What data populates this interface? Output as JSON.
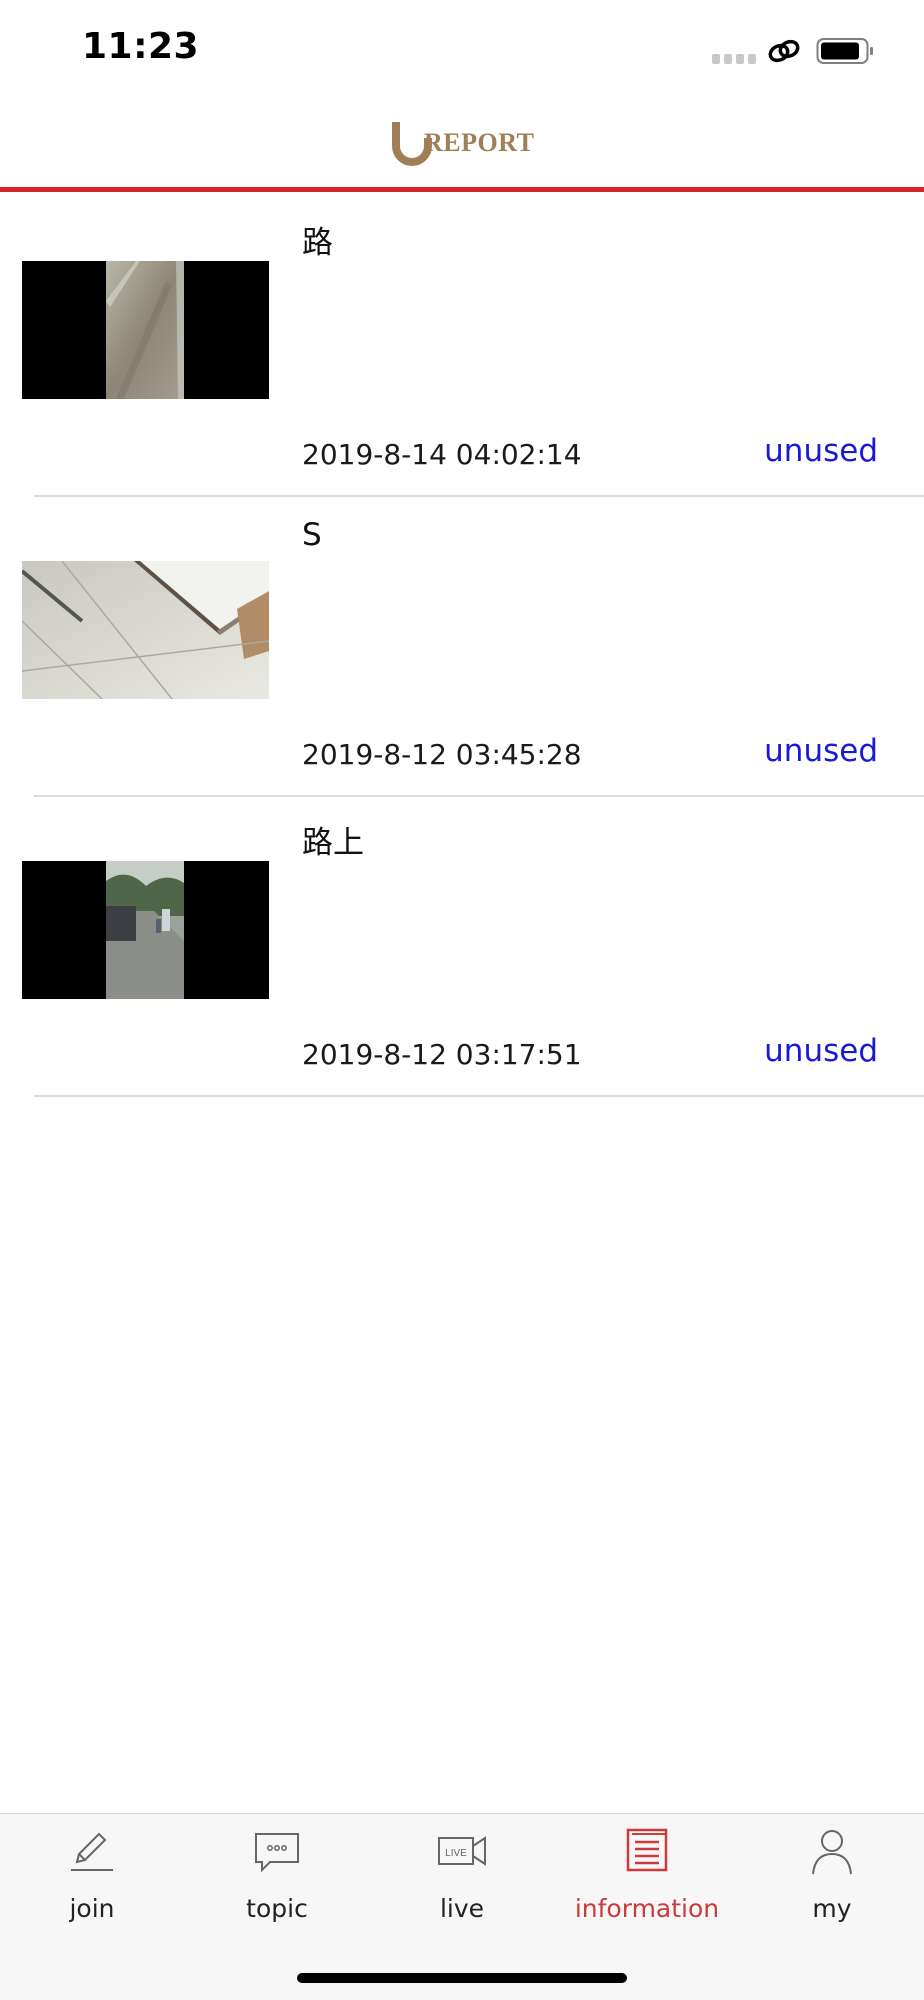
{
  "status_bar": {
    "time": "11:23"
  },
  "header": {
    "logo_letter": "U",
    "logo_text": "REPORT",
    "accent_color": "#d5262c",
    "logo_color": "#a07f57"
  },
  "feed": {
    "items": [
      {
        "title": "路",
        "timestamp": "2019-8-14 04:02:14",
        "status": "unused",
        "thumbnail": "video-thumbnail-road-wet"
      },
      {
        "title": "S",
        "timestamp": "2019-8-12 03:45:28",
        "status": "unused",
        "thumbnail": "video-thumbnail-floor-tiles"
      },
      {
        "title": "路上",
        "timestamp": "2019-8-12 03:17:51",
        "status": "unused",
        "thumbnail": "video-thumbnail-street"
      }
    ],
    "status_color": "#1a1ad6"
  },
  "tab_bar": {
    "tabs": [
      {
        "label": "join",
        "icon": "pencil-icon",
        "active": false
      },
      {
        "label": "topic",
        "icon": "chat-bubble-icon",
        "active": false
      },
      {
        "label": "live",
        "icon": "live-camera-icon",
        "active": false
      },
      {
        "label": "information",
        "icon": "document-icon",
        "active": true
      },
      {
        "label": "my",
        "icon": "person-icon",
        "active": false
      }
    ],
    "active_color": "#cc3a3c"
  }
}
